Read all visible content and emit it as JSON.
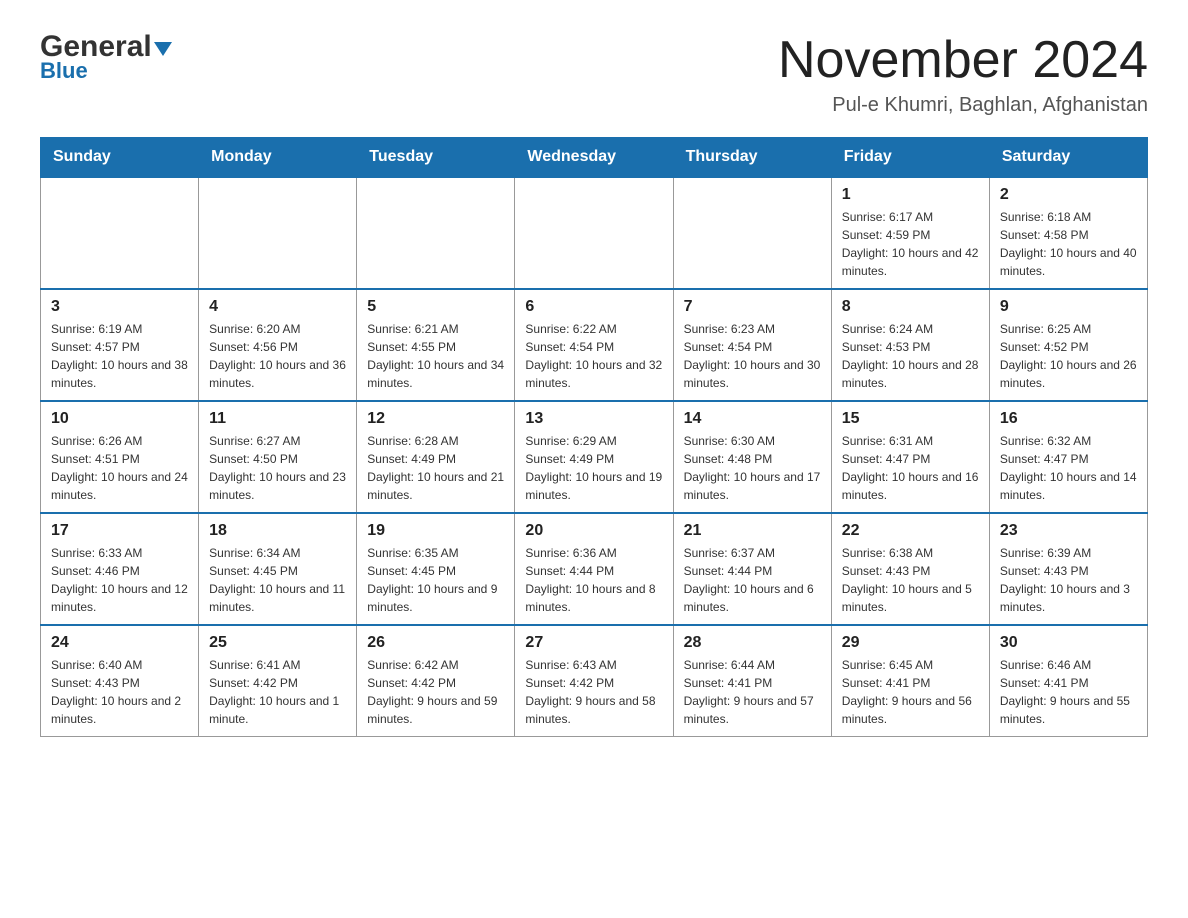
{
  "header": {
    "logo_line1": "General",
    "logo_line2": "Blue",
    "month_title": "November 2024",
    "location": "Pul-e Khumri, Baghlan, Afghanistan"
  },
  "calendar": {
    "days_of_week": [
      "Sunday",
      "Monday",
      "Tuesday",
      "Wednesday",
      "Thursday",
      "Friday",
      "Saturday"
    ],
    "weeks": [
      [
        {
          "day": "",
          "info": ""
        },
        {
          "day": "",
          "info": ""
        },
        {
          "day": "",
          "info": ""
        },
        {
          "day": "",
          "info": ""
        },
        {
          "day": "",
          "info": ""
        },
        {
          "day": "1",
          "info": "Sunrise: 6:17 AM\nSunset: 4:59 PM\nDaylight: 10 hours and 42 minutes."
        },
        {
          "day": "2",
          "info": "Sunrise: 6:18 AM\nSunset: 4:58 PM\nDaylight: 10 hours and 40 minutes."
        }
      ],
      [
        {
          "day": "3",
          "info": "Sunrise: 6:19 AM\nSunset: 4:57 PM\nDaylight: 10 hours and 38 minutes."
        },
        {
          "day": "4",
          "info": "Sunrise: 6:20 AM\nSunset: 4:56 PM\nDaylight: 10 hours and 36 minutes."
        },
        {
          "day": "5",
          "info": "Sunrise: 6:21 AM\nSunset: 4:55 PM\nDaylight: 10 hours and 34 minutes."
        },
        {
          "day": "6",
          "info": "Sunrise: 6:22 AM\nSunset: 4:54 PM\nDaylight: 10 hours and 32 minutes."
        },
        {
          "day": "7",
          "info": "Sunrise: 6:23 AM\nSunset: 4:54 PM\nDaylight: 10 hours and 30 minutes."
        },
        {
          "day": "8",
          "info": "Sunrise: 6:24 AM\nSunset: 4:53 PM\nDaylight: 10 hours and 28 minutes."
        },
        {
          "day": "9",
          "info": "Sunrise: 6:25 AM\nSunset: 4:52 PM\nDaylight: 10 hours and 26 minutes."
        }
      ],
      [
        {
          "day": "10",
          "info": "Sunrise: 6:26 AM\nSunset: 4:51 PM\nDaylight: 10 hours and 24 minutes."
        },
        {
          "day": "11",
          "info": "Sunrise: 6:27 AM\nSunset: 4:50 PM\nDaylight: 10 hours and 23 minutes."
        },
        {
          "day": "12",
          "info": "Sunrise: 6:28 AM\nSunset: 4:49 PM\nDaylight: 10 hours and 21 minutes."
        },
        {
          "day": "13",
          "info": "Sunrise: 6:29 AM\nSunset: 4:49 PM\nDaylight: 10 hours and 19 minutes."
        },
        {
          "day": "14",
          "info": "Sunrise: 6:30 AM\nSunset: 4:48 PM\nDaylight: 10 hours and 17 minutes."
        },
        {
          "day": "15",
          "info": "Sunrise: 6:31 AM\nSunset: 4:47 PM\nDaylight: 10 hours and 16 minutes."
        },
        {
          "day": "16",
          "info": "Sunrise: 6:32 AM\nSunset: 4:47 PM\nDaylight: 10 hours and 14 minutes."
        }
      ],
      [
        {
          "day": "17",
          "info": "Sunrise: 6:33 AM\nSunset: 4:46 PM\nDaylight: 10 hours and 12 minutes."
        },
        {
          "day": "18",
          "info": "Sunrise: 6:34 AM\nSunset: 4:45 PM\nDaylight: 10 hours and 11 minutes."
        },
        {
          "day": "19",
          "info": "Sunrise: 6:35 AM\nSunset: 4:45 PM\nDaylight: 10 hours and 9 minutes."
        },
        {
          "day": "20",
          "info": "Sunrise: 6:36 AM\nSunset: 4:44 PM\nDaylight: 10 hours and 8 minutes."
        },
        {
          "day": "21",
          "info": "Sunrise: 6:37 AM\nSunset: 4:44 PM\nDaylight: 10 hours and 6 minutes."
        },
        {
          "day": "22",
          "info": "Sunrise: 6:38 AM\nSunset: 4:43 PM\nDaylight: 10 hours and 5 minutes."
        },
        {
          "day": "23",
          "info": "Sunrise: 6:39 AM\nSunset: 4:43 PM\nDaylight: 10 hours and 3 minutes."
        }
      ],
      [
        {
          "day": "24",
          "info": "Sunrise: 6:40 AM\nSunset: 4:43 PM\nDaylight: 10 hours and 2 minutes."
        },
        {
          "day": "25",
          "info": "Sunrise: 6:41 AM\nSunset: 4:42 PM\nDaylight: 10 hours and 1 minute."
        },
        {
          "day": "26",
          "info": "Sunrise: 6:42 AM\nSunset: 4:42 PM\nDaylight: 9 hours and 59 minutes."
        },
        {
          "day": "27",
          "info": "Sunrise: 6:43 AM\nSunset: 4:42 PM\nDaylight: 9 hours and 58 minutes."
        },
        {
          "day": "28",
          "info": "Sunrise: 6:44 AM\nSunset: 4:41 PM\nDaylight: 9 hours and 57 minutes."
        },
        {
          "day": "29",
          "info": "Sunrise: 6:45 AM\nSunset: 4:41 PM\nDaylight: 9 hours and 56 minutes."
        },
        {
          "day": "30",
          "info": "Sunrise: 6:46 AM\nSunset: 4:41 PM\nDaylight: 9 hours and 55 minutes."
        }
      ]
    ]
  }
}
